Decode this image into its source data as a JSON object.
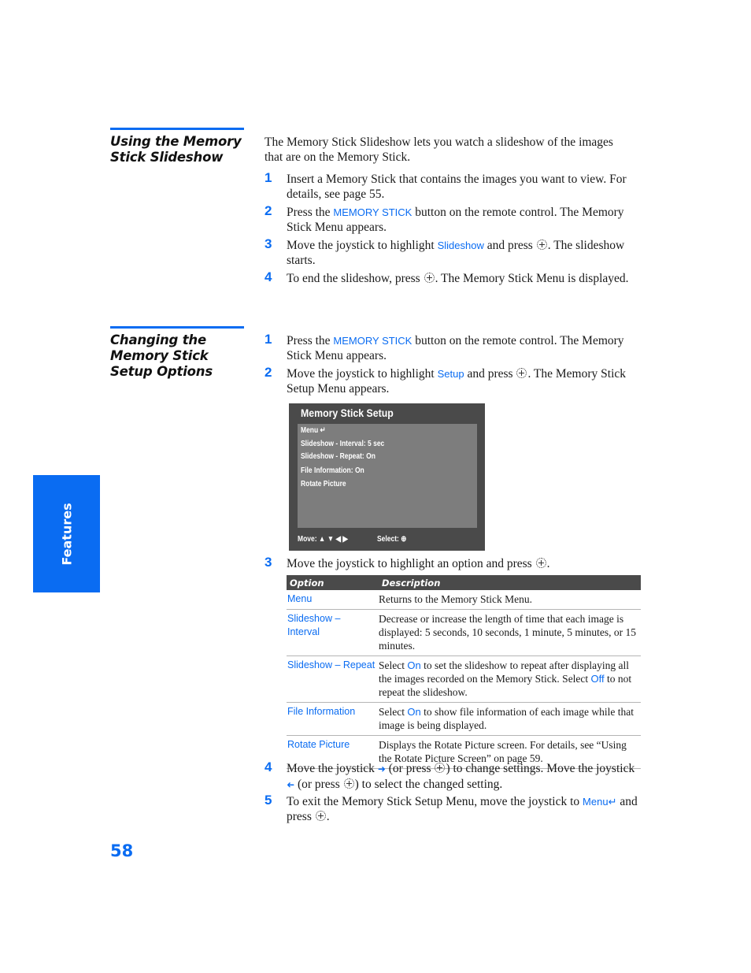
{
  "section1": {
    "title_line1": "Using the Memory",
    "title_line2": "Stick Slideshow",
    "intro": "The Memory Stick Slideshow lets you watch a slideshow of the images that are on the Memory Stick.",
    "steps": [
      {
        "num": "1",
        "text": "Insert a Memory Stick that contains the images you want to view. For details, see page 55."
      },
      {
        "num": "2",
        "pre": "Press the ",
        "key": "MEMORY STICK",
        "post": " button on the remote control. The Memory Stick Menu appears."
      },
      {
        "num": "3",
        "pre": "Move the joystick to highlight ",
        "key": "Slideshow",
        "mid": " and press ",
        "post": ". The slideshow starts."
      },
      {
        "num": "4",
        "pre": "To end the slideshow, press ",
        "post": ". The Memory Stick Menu is displayed."
      }
    ]
  },
  "section2": {
    "title_line1": "Changing the",
    "title_line2": "Memory Stick",
    "title_line3": "Setup Options",
    "steps": [
      {
        "num": "1",
        "pre": "Press the ",
        "key": "MEMORY STICK",
        "post": " button on the remote control. The Memory Stick Menu appears."
      },
      {
        "num": "2",
        "pre": "Move the joystick to highlight ",
        "key": "Setup",
        "mid": " and press ",
        "post": ". The Memory Stick Setup Menu appears."
      },
      {
        "num": "3",
        "pre": "Move the joystick to highlight an option and press ",
        "post": "."
      },
      {
        "num": "4",
        "pre": "Move the joystick ",
        "mid1": " (or press ",
        "mid2": ") to change settings. Move the joystick ",
        "mid3": " (or press ",
        "post": ") to select the changed setting."
      },
      {
        "num": "5",
        "pre": "To exit the Memory Stick Setup Menu, move the joystick to ",
        "key": "Menu",
        "post": " and press ",
        "end": "."
      }
    ]
  },
  "screen": {
    "title": "Memory Stick Setup",
    "items": [
      "Menu",
      "Slideshow - Interval: 5 sec",
      "Slideshow - Repeat: On",
      "File Information: On",
      "Rotate Picture"
    ],
    "move_label": "Move:",
    "select_label": "Select:"
  },
  "table": {
    "headers": [
      "Option",
      "Description"
    ],
    "rows": [
      {
        "option": "Menu",
        "description": "Returns to the Memory Stick Menu."
      },
      {
        "option": "Slideshow – Interval",
        "description": "Decrease or increase the length of time that each image is displayed: 5 seconds, 10 seconds, 1 minute, 5 minutes, or 15 minutes."
      },
      {
        "option": "Slideshow – Repeat",
        "d_pre": "Select ",
        "d_on": "On",
        "d_mid": " to set the slideshow to repeat after displaying all the images recorded on the Memory Stick. Select ",
        "d_off": "Off",
        "d_post": " to not repeat the slideshow."
      },
      {
        "option": "File Information",
        "d_pre": "Select ",
        "d_on": "On",
        "d_post": " to show file information of each image while that image is being displayed."
      },
      {
        "option": "Rotate Picture",
        "description": "Displays the Rotate Picture screen. For details, see “Using the Rotate Picture Screen” on page 59."
      }
    ]
  },
  "side_tab": {
    "label": "Features"
  },
  "page_number": "58",
  "colors": {
    "accent": "#0a6cf2",
    "screen_bg": "#4a4a4a",
    "screen_panel": "#7d7d7d"
  }
}
